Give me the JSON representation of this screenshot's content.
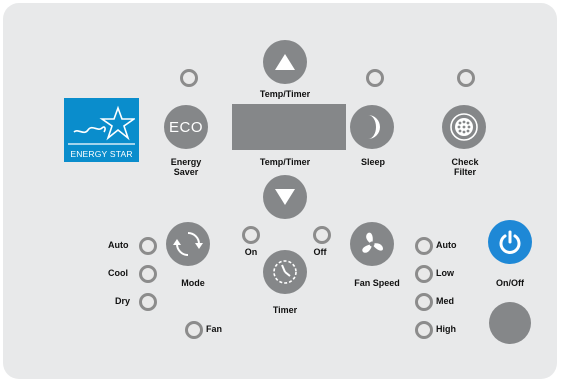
{
  "branding": {
    "energy_star_label": "ENERGY STAR"
  },
  "buttons": {
    "eco_label": "ECO",
    "temp_up_label": "Temp/Timer",
    "temp_down_label": "Temp/Timer",
    "energy_saver_label": "Energy\nSaver",
    "sleep_label": "Sleep",
    "check_filter_label": "Check\nFilter",
    "mode_label": "Mode",
    "timer_label": "Timer",
    "fan_speed_label": "Fan Speed",
    "on_off_label": "On/Off"
  },
  "indicators": {
    "mode": [
      "Auto",
      "Cool",
      "Dry"
    ],
    "fan": "Fan",
    "timer_on": "On",
    "timer_off": "Off",
    "fan_speed": [
      "Auto",
      "Low",
      "Med",
      "High"
    ]
  },
  "colors": {
    "panel": "#e8e9ea",
    "button": "#858789",
    "power": "#1e88d6",
    "energy_star": "#0a8dcc"
  }
}
